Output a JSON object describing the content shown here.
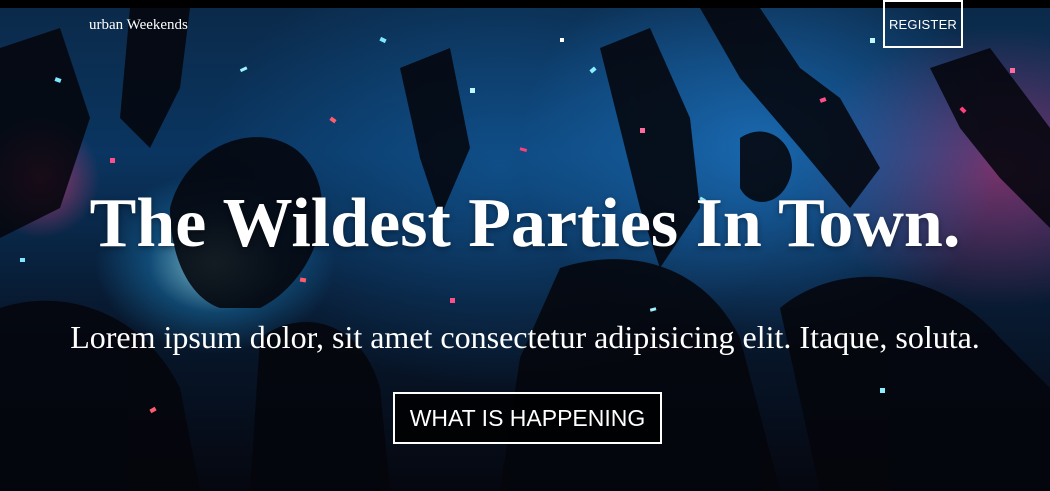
{
  "nav": {
    "brand": "urban Weekends",
    "register_label": "REGISTER"
  },
  "hero": {
    "headline": "The Wildest Parties In Town.",
    "subline": "Lorem ipsum dolor, sit amet consectetur adipisicing elit. Itaque, soluta.",
    "cta_label": "WHAT IS HAPPENING",
    "background_image": "party-crowd-confetti"
  },
  "colors": {
    "text": "#ffffff",
    "accent_blue": "#1e8fd6",
    "accent_pink": "#d2327a",
    "dark": "#04060d"
  }
}
